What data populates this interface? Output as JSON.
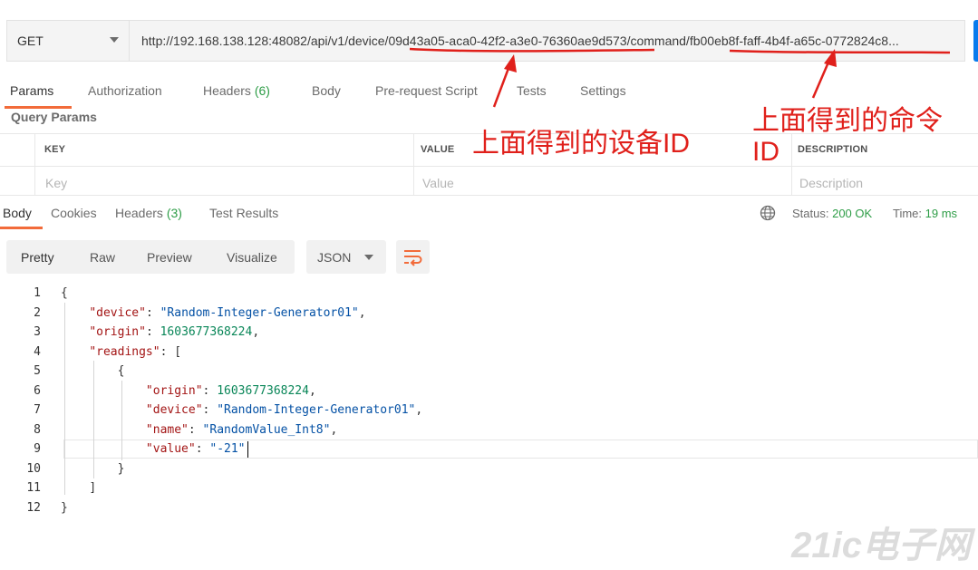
{
  "request": {
    "method": "GET",
    "url_prefix": "http://192.168.138.128:48082/api/v1/device/",
    "device_id": "09d43a05-aca0-42f2-a3e0-76360ae9d573",
    "url_middle": "/command/",
    "command_id": "fb00eb8f-faff-4b4f-a65c-0772824c8",
    "url_ellipsis": "..."
  },
  "request_tabs": [
    {
      "label": "Params"
    },
    {
      "label": "Authorization"
    },
    {
      "label": "Headers",
      "count": "(6)"
    },
    {
      "label": "Body"
    },
    {
      "label": "Pre-request Script"
    },
    {
      "label": "Tests"
    },
    {
      "label": "Settings"
    }
  ],
  "query_params": {
    "section_label": "Query Params",
    "headers": [
      "KEY",
      "VALUE",
      "DESCRIPTION"
    ],
    "placeholders": [
      "Key",
      "Value",
      "Description"
    ]
  },
  "response_tabs": [
    {
      "label": "Body"
    },
    {
      "label": "Cookies"
    },
    {
      "label": "Headers",
      "count": "(3)"
    },
    {
      "label": "Test Results"
    }
  ],
  "status": {
    "label": "Status:",
    "value": "200 OK",
    "time_label": "Time:",
    "time_value": "19 ms"
  },
  "view_modes": [
    "Pretty",
    "Raw",
    "Preview",
    "Visualize"
  ],
  "format": "JSON",
  "line_numbers": [
    "1",
    "2",
    "3",
    "4",
    "5",
    "6",
    "7",
    "8",
    "9",
    "10",
    "11",
    "12"
  ],
  "code": {
    "open_brace": "{",
    "device_key": "\"device\"",
    "device_val": "\"Random-Integer-Generator01\"",
    "origin_key": "\"origin\"",
    "origin_val": "1603677368224",
    "readings_key": "\"readings\"",
    "open_bracket": "[",
    "r_open": "{",
    "r_origin_key": "\"origin\"",
    "r_origin_val": "1603677368224",
    "r_device_key": "\"device\"",
    "r_device_val": "\"Random-Integer-Generator01\"",
    "r_name_key": "\"name\"",
    "r_name_val": "\"RandomValue_Int8\"",
    "r_value_key": "\"value\"",
    "r_value_val": "\"-21\"",
    "r_close": "}",
    "close_bracket": "]",
    "close_brace": "}"
  },
  "annotations": {
    "device_note": "上面得到的设备ID",
    "command_note_line1": "上面得到的命令",
    "command_note_line2": "ID",
    "accent": "#e0201b"
  },
  "watermark": "21ic电子网"
}
